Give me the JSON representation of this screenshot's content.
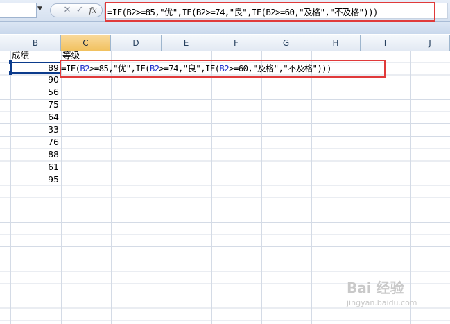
{
  "formula_bar": {
    "formula": "=IF(B2>=85,\"优\",IF(B2>=74,\"良\",IF(B2>=60,\"及格\",\"不及格\")))"
  },
  "columns": [
    "B",
    "C",
    "D",
    "E",
    "F",
    "G",
    "H",
    "I",
    "J"
  ],
  "headers": {
    "b1": "成绩",
    "c1": "等级"
  },
  "scores": [
    89,
    90,
    56,
    75,
    64,
    33,
    76,
    88,
    61,
    95
  ],
  "cell_edit": {
    "prefix": "=IF(",
    "ref1": "B2",
    "part2": ">=85,\"优\",IF(",
    "ref2": "B2",
    "part3": ">=74,\"良\",IF(",
    "ref3": "B2",
    "part4": ">=60,\"及格\",\"不及格\")))"
  },
  "icons": [
    "name-box-dropdown-icon",
    "cancel-icon",
    "enter-icon",
    "insert-function-icon"
  ],
  "colors": {
    "highlight": "#e03a3a",
    "active_header": "#f1c15f",
    "reference": "#2233cc"
  },
  "watermark": {
    "brand": "Bai 经验",
    "url": "jingyan.baidu.com"
  }
}
